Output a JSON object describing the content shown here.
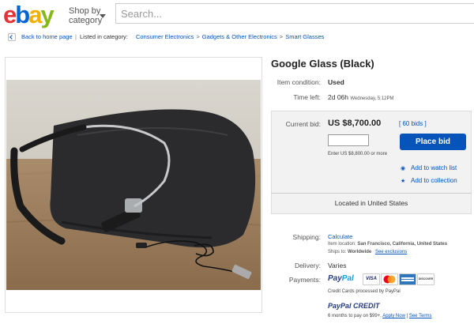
{
  "header": {
    "logo": [
      "e",
      "b",
      "a",
      "y"
    ],
    "logo_colors": [
      "#e53238",
      "#0064d2",
      "#f5af02",
      "#86b817"
    ],
    "shop_by_line1": "Shop by",
    "shop_by_line2": "category",
    "search_placeholder": "Search..."
  },
  "breadcrumb": {
    "back_label": "Back to home page",
    "sep": "|",
    "listed_in": "Listed in category:",
    "categories": [
      "Consumer Electronics",
      "Gadgets & Other Electronics",
      "Smart Glasses"
    ],
    "gt": ">"
  },
  "item": {
    "title": "Google Glass (Black)",
    "condition_label": "Item condition:",
    "condition_value": "Used",
    "time_left_label": "Time left:",
    "time_left_value": "2d 06h",
    "time_left_detail": "Wednesday, 5:12PM"
  },
  "bid": {
    "current_bid_label": "Current bid:",
    "current_bid_value": "US $8,700.00",
    "bids_link": "[ 60 bids ]",
    "place_bid_label": "Place bid",
    "enter_text": "Enter US $8,800.00 or more",
    "watch_label": "Add to watch list",
    "collection_label": "Add to collection",
    "located": "Located in United States"
  },
  "shipping": {
    "label": "Shipping:",
    "calculate": "Calculate",
    "item_location_label": "Item location:",
    "item_location_value": "San Francisco, California, United States",
    "ships_to_label": "Ships to:",
    "ships_to_value": "Worldwide",
    "exclusions": "See exclusions"
  },
  "delivery": {
    "label": "Delivery:",
    "value": "Varies"
  },
  "payments": {
    "label": "Payments:",
    "paypal_pay": "Pay",
    "paypal_pal": "Pal",
    "cards": [
      "VISA",
      "",
      "",
      "DISCOVER"
    ],
    "credit_processed": "Credit Cards processed by PayPal",
    "credit_brand": "PayPal CREDIT",
    "months_text": "6 months to pay on $99+.",
    "apply_now": "Apply Now",
    "see_terms": "See Terms",
    "sep": "|"
  },
  "colors": {
    "link": "#0654ba",
    "place_bid_bg": "#0654ba",
    "panel_bg": "#f2f2f2"
  }
}
